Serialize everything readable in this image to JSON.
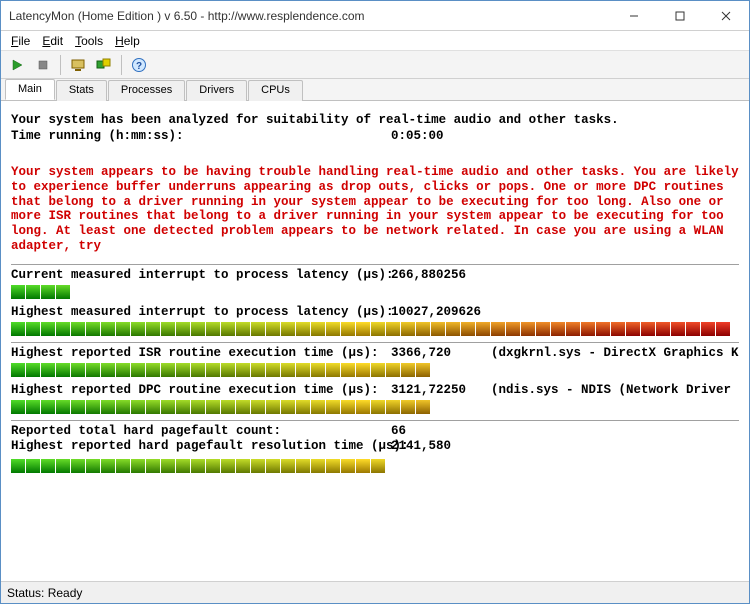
{
  "window": {
    "title": "LatencyMon  (Home Edition )  v 6.50 - http://www.resplendence.com"
  },
  "menu": {
    "file": "File",
    "edit": "Edit",
    "tools": "Tools",
    "help": "Help"
  },
  "tabs": {
    "main": "Main",
    "stats": "Stats",
    "processes": "Processes",
    "drivers": "Drivers",
    "cpus": "CPUs"
  },
  "main": {
    "analyzed_line": "Your system has been analyzed for suitability of real-time audio and other tasks.",
    "time_label": "Time running (h:mm:ss):",
    "time_value": "0:05:00",
    "warning_text": "Your system appears to be having trouble handling real-time audio and other tasks. You are likely to experience buffer underruns appearing as drop outs, clicks or pops. One or more DPC routines that belong to a driver running in your system appear to be executing for too long. Also one or more ISR routines that belong to a driver running in your system appear to be executing for too long. At least one detected problem appears to be network related. In case you are using a WLAN adapter, try",
    "metrics": {
      "m1_label": "Current measured interrupt to process latency (µs):",
      "m1_value": "266,880256",
      "m2_label": "Highest measured interrupt to process latency (µs):",
      "m2_value": "10027,209626",
      "m3_label": "Highest reported ISR routine execution time (µs):",
      "m3_value": "3366,720",
      "m3_detail": "(dxgkrnl.sys - DirectX Graphics Kernel, Microsoft Corporation)",
      "m4_label": "Highest reported DPC routine execution time (µs):",
      "m4_value": "3121,72250",
      "m4_detail": "(ndis.sys - NDIS (Network Driver Interface Specification)",
      "m5_label": "Reported total hard pagefault count:",
      "m5_value": "66",
      "m6_label": "Highest reported hard pagefault resolution time (µs):",
      "m6_value": "2141,580"
    }
  },
  "status": {
    "text": "Status: Ready"
  },
  "colors": {
    "warn_red": "#d00000"
  }
}
